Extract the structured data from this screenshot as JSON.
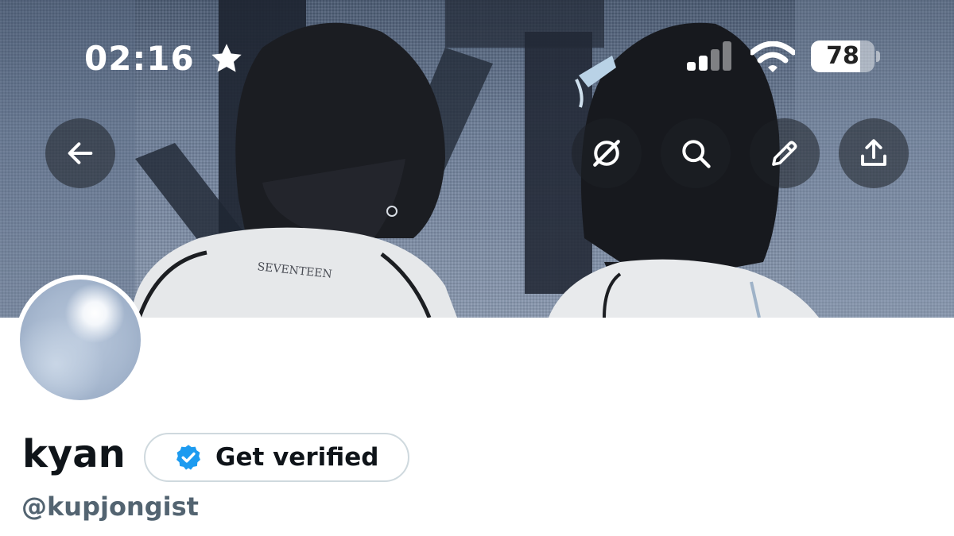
{
  "status_bar": {
    "time": "02:16",
    "battery_level": "78",
    "battery_fraction": 0.78,
    "icons": [
      "star-icon",
      "cellular-signal-icon",
      "wifi-icon",
      "battery-icon"
    ]
  },
  "nav": {
    "buttons": [
      "back-arrow-icon",
      "grok-icon",
      "search-icon",
      "pencil-icon",
      "share-icon"
    ]
  },
  "banner": {
    "jacket_text": "SEVENTEEN"
  },
  "profile": {
    "display_name": "kyan",
    "handle": "@kupjongist",
    "verify_button": "Get verified"
  },
  "colors": {
    "verified_blue": "#1d9bf0",
    "text_primary": "#0f1419",
    "text_secondary": "#536471",
    "button_border": "#cfd9de"
  }
}
